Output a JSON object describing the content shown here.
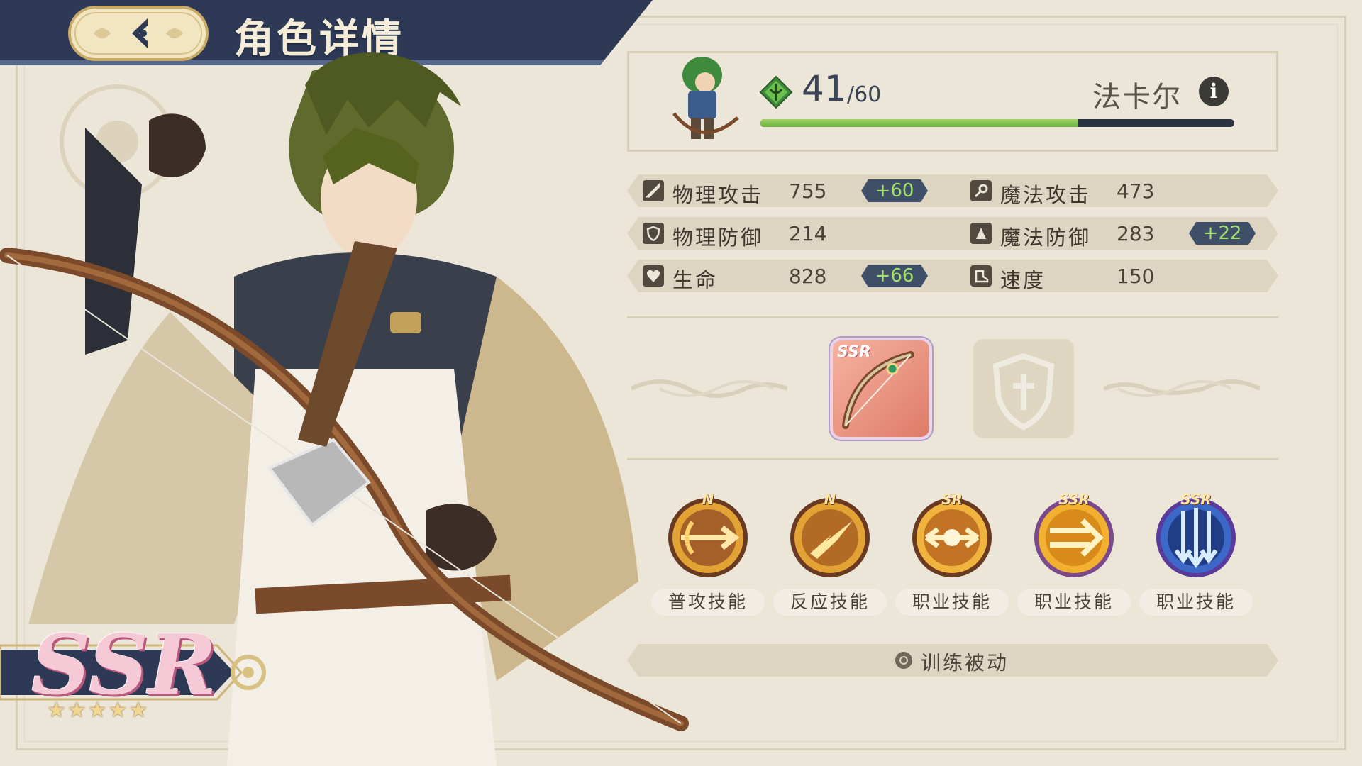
{
  "header": {
    "title": "角色详情"
  },
  "character": {
    "name": "法卡尔",
    "level": "41",
    "level_max": "/60",
    "xp_fraction": 0.67,
    "rarity": "SSR",
    "stars": "★★★★★",
    "star_count": 5
  },
  "stats": [
    {
      "label": "物理攻击",
      "value": "755",
      "bonus": "+60",
      "icon": "sword-icon"
    },
    {
      "label": "魔法攻击",
      "value": "473",
      "bonus": "",
      "icon": "wand-icon"
    },
    {
      "label": "物理防御",
      "value": "214",
      "bonus": "",
      "icon": "shield-icon"
    },
    {
      "label": "魔法防御",
      "value": "283",
      "bonus": "+22",
      "icon": "magic-shield-icon"
    },
    {
      "label": "生命",
      "value": "828",
      "bonus": "+66",
      "icon": "heart-icon"
    },
    {
      "label": "速度",
      "value": "150",
      "bonus": "",
      "icon": "boot-icon"
    }
  ],
  "equipment": {
    "weapon": {
      "rarity": "SSR",
      "icon": "bow-icon"
    },
    "armor": {
      "icon": "empty-shield-slot-icon"
    }
  },
  "skills": [
    {
      "rank": "N",
      "name": "普攻技能",
      "icon": "arrow-strike-icon"
    },
    {
      "rank": "N",
      "name": "反应技能",
      "icon": "lightning-burst-icon"
    },
    {
      "rank": "SR",
      "name": "职业技能",
      "icon": "cross-arrows-icon"
    },
    {
      "rank": "SSR",
      "name": "职业技能",
      "icon": "double-arrow-icon"
    },
    {
      "rank": "SSR",
      "name": "职业技能",
      "icon": "arrow-rain-icon"
    }
  ],
  "passive": {
    "label": "训练被动",
    "icon": "search-icon"
  },
  "colors": {
    "navy": "#2e3a55",
    "bonus_green": "#9fe16b",
    "xp_green": "#8cc653",
    "panel": "#ece6d8"
  }
}
